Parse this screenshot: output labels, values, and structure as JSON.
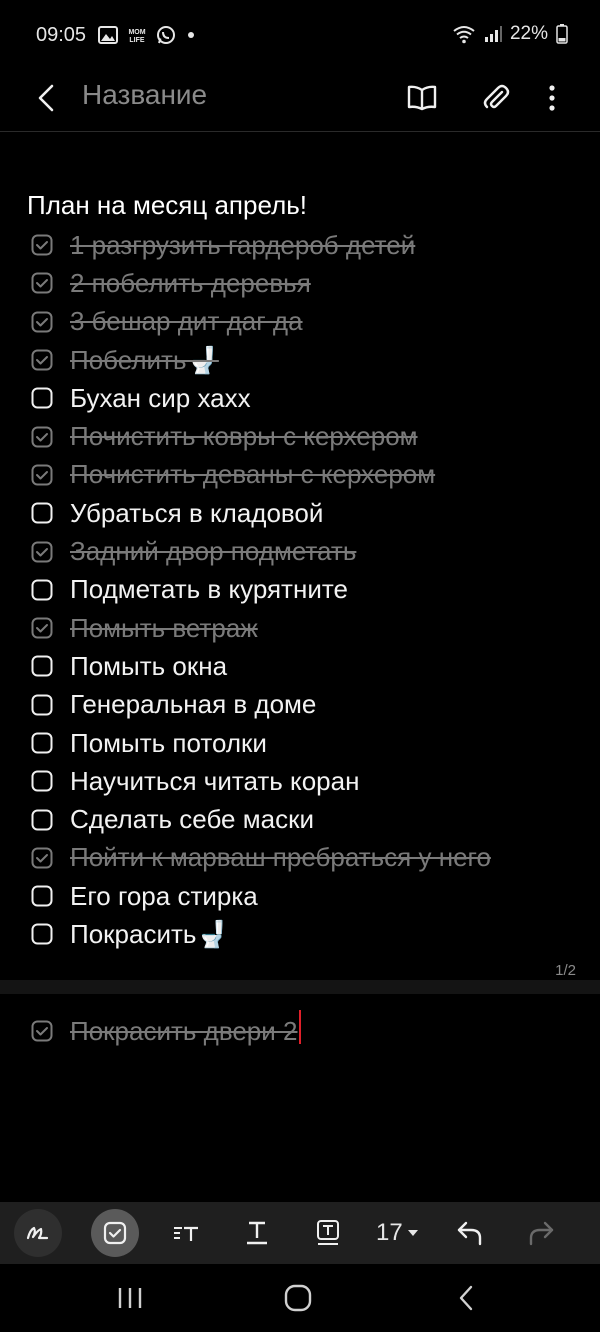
{
  "status_bar": {
    "time": "09:05",
    "notification_icons": [
      "image-icon",
      "momlife-app-icon",
      "whatsapp-icon",
      "dot-icon"
    ],
    "momlife_label": "MOM LIFE",
    "battery_text": "22%"
  },
  "header": {
    "title_placeholder": "Название",
    "actions": [
      "book-icon",
      "attach-icon",
      "more-icon"
    ]
  },
  "note": {
    "heading": "План на месяц апрель!",
    "items": [
      {
        "text": "1 разгрузить гардероб детей",
        "checked": true
      },
      {
        "text": "2 побелить деревья",
        "checked": true
      },
      {
        "text": "3  бешар дит даг да",
        "checked": true
      },
      {
        "text": "Побелить🚽",
        "checked": true
      },
      {
        "text": "Бухан сир хахх",
        "checked": false
      },
      {
        "text": "Почистить ковры с керхером",
        "checked": true
      },
      {
        "text": "Почистить деваны с керхером",
        "checked": true
      },
      {
        "text": "Убраться в кладовой",
        "checked": false
      },
      {
        "text": "Задний двор подметать",
        "checked": true
      },
      {
        "text": "Подметать в курятните",
        "checked": false
      },
      {
        "text": "Помыть ветраж ",
        "checked": true
      },
      {
        "text": "Помыть окна",
        "checked": false
      },
      {
        "text": "Генеральная в доме",
        "checked": false
      },
      {
        "text": "Помыть потолки",
        "checked": false
      },
      {
        "text": "Научиться читать коран",
        "checked": false
      },
      {
        "text": "Сделать себе маски",
        "checked": false
      },
      {
        "text": "Пойти к марваш пребраться у него",
        "checked": true
      },
      {
        "text": "Его гора стирка",
        "checked": false
      },
      {
        "text": "Покрасить🚽",
        "checked": false
      }
    ],
    "page_indicator": "1/2",
    "page2_items": [
      {
        "text": "Покрасить двери 2",
        "checked": true
      }
    ]
  },
  "toolbar": {
    "font_size": "17",
    "tools": [
      "pen-icon",
      "checkbox-icon",
      "text-style-icon",
      "text-underline-icon",
      "text-box-icon",
      "font-size-dropdown",
      "undo-icon",
      "redo-icon"
    ]
  },
  "navbar": {
    "buttons": [
      "recents-icon",
      "home-icon",
      "back-icon"
    ]
  },
  "colors": {
    "background": "#000000",
    "text": "#f2f2f2",
    "done_text": "#7a7a7a",
    "caret": "#e0202a",
    "toolbar": "#1f1f1f"
  }
}
